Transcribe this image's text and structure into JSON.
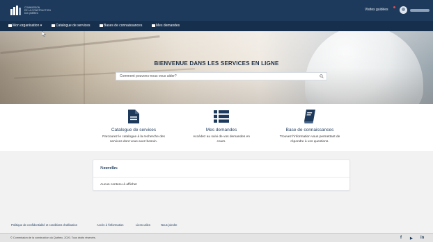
{
  "header": {
    "logo_lines": [
      "COMMISSION",
      "DE LA CONSTRUCTION",
      "DU QUÉBEC"
    ],
    "visites_label": "Visites guidées"
  },
  "nav": {
    "items": [
      {
        "label": "Mon organisation",
        "icon": "building-icon",
        "has_dropdown": true
      },
      {
        "label": "Catalogue de services",
        "icon": "document-icon"
      },
      {
        "label": "Bases de connaissances",
        "icon": "knowledge-icon"
      },
      {
        "label": "Mes demandes",
        "icon": "list-icon"
      }
    ]
  },
  "hero": {
    "title": "BIENVENUE DANS LES SERVICES EN LIGNE",
    "search_placeholder": "Comment pouvons-nous vous aider?"
  },
  "services": [
    {
      "icon": "document-icon",
      "title": "Catalogue de services",
      "desc_lines": [
        "Parcourez le catalogue à la recherche des",
        "services dont vous avez besoin."
      ]
    },
    {
      "icon": "list-icon",
      "title": "Mes demandes",
      "desc_lines": [
        "Accédez au suivi de vos demandes en",
        "cours."
      ]
    },
    {
      "icon": "book-icon",
      "title": "Base de connaissances",
      "desc_lines": [
        "Trouvez l'information vous permettant de",
        "répondre à vos questions."
      ]
    }
  ],
  "news": {
    "title": "Nouvelles",
    "empty_text": "Aucun contenu à afficher"
  },
  "footer": {
    "links": [
      "Politique de confidentialité et conditions d'utilisation",
      "Accès à l'information",
      "Liens utiles",
      "Nous joindre"
    ],
    "copyright": "© Commission de la construction du Québec, 2020. Tous droits réservés.",
    "social": {
      "facebook": "f",
      "youtube": "▶",
      "linkedin": "in"
    }
  },
  "colors": {
    "primary": "#1d3a5c",
    "nav": "#162f4c",
    "accent_dot": "#e05050"
  }
}
